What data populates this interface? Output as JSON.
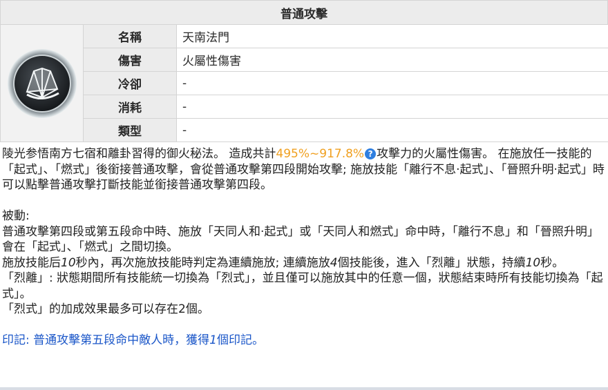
{
  "header": {
    "title": "普通攻擊"
  },
  "skill_icon": {
    "icon": "fan-icon"
  },
  "info": {
    "rows": [
      {
        "label": "名稱",
        "value": "天南法門"
      },
      {
        "label": "傷害",
        "value": "火屬性傷害"
      },
      {
        "label": "冷卻",
        "value": "-"
      },
      {
        "label": "消耗",
        "value": "-"
      },
      {
        "label": "類型",
        "value": "-"
      }
    ]
  },
  "description": {
    "intro_before": "陵光参悟南方七宿和離卦習得的御火秘法。 造成共計",
    "intro_highlight": "495%~917.8%",
    "intro_help_icon": "question-icon",
    "intro_after": "攻擊力的火屬性傷害。 在施放任一技能的「起式」、「燃式」後銜接普通攻擊，會從普通攻擊第四段開始攻擊; 施放技能「離行不息·起式」、「晉照升明·起式」時可以點擊普通攻擊打斷技能並銜接普通攻擊第四段。",
    "passive_title": "被動:",
    "passive_1": "普通攻擊第四段或第五段命中時、施放「天同人和·起式」或「天同人和燃式」命中時，「離行不息」和「晉照升明」會在「起式」、「燃式」之間切換。",
    "passive_2a": "施放技能后",
    "passive_2_num1": "10",
    "passive_2b": "秒內，再次施放技能時判定為連續施放; 連續施放",
    "passive_2_num2": "4",
    "passive_2c": "個技能後，進入「烈離」狀態，持續",
    "passive_2_num3": "10",
    "passive_2d": "秒。",
    "passive_3": "「烈離」: 狀態期間所有技能統一切換為「烈式」，並且僅可以施放其中的任意一個，狀態結束時所有技能切換為「起式」。",
    "passive_4": "「烈式」的加成效果最多可以存在2個。",
    "mark_a": "印記: 普通攻擊第五段命中敵人時，獲得",
    "mark_num": "1",
    "mark_b": "個印記。"
  },
  "colors": {
    "highlight": "#f0a020",
    "mark_text": "#1a56c8",
    "header_bg": "#ececec"
  }
}
